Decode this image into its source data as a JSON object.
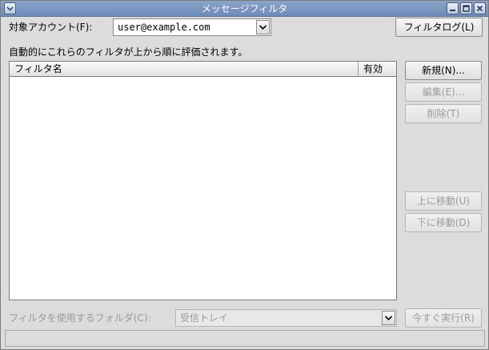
{
  "window": {
    "title": "メッセージフィルタ"
  },
  "account": {
    "label": "対象アカウント(F):",
    "value": "user@example.com"
  },
  "buttons": {
    "filter_log": "フィルタログ(L)",
    "new": "新規(N)...",
    "edit": "編集(E)...",
    "delete": "削除(T)",
    "move_up": "上に移動(U)",
    "move_down": "下に移動(D)",
    "run_now": "今すぐ実行(R)"
  },
  "description": "自動的にこれらのフィルタが上から順に評価されます。",
  "list": {
    "columns": [
      "フィルタ名",
      "有効"
    ],
    "rows": []
  },
  "folder": {
    "label": "フィルタを使用するフォルダ(C):",
    "value": "受信トレイ"
  },
  "icons": {
    "window_menu": "window-menu-icon",
    "minimize": "minimize-icon",
    "maximize": "maximize-icon",
    "close": "close-icon",
    "dropdown": "chevron-down-icon"
  }
}
